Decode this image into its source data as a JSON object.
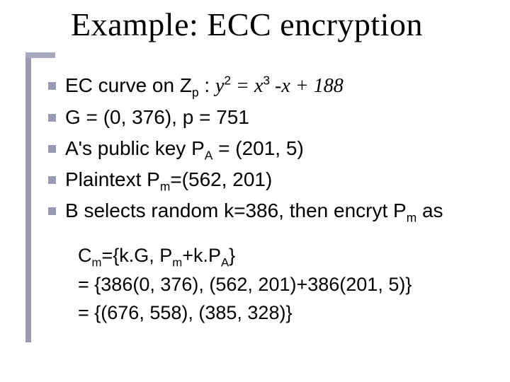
{
  "title": "Example: ECC encryption",
  "bullets": {
    "b1_prefix": "EC curve on Z",
    "b1_sub": "p",
    "b1_colon": " : ",
    "b1_y": "y",
    "b1_ysup": "2",
    "b1_eq": " = ",
    "b1_xcubed": "x",
    "b1_xsup": "3",
    "b1_mid": " -",
    "b1_x2": "x + ",
    "b1_const": "188",
    "b2": "G = (0, 376), p = 751",
    "b3_pre": "A's public key P",
    "b3_sub": "A",
    "b3_post": " = (201, 5)",
    "b4_pre": "Plaintext P",
    "b4_sub": "m",
    "b4_post": "=(562, 201)",
    "b5_pre": "B selects random k=386, then encryt P",
    "b5_sub": "m",
    "b5_post": " as"
  },
  "deriv": {
    "l1a": "C",
    "l1a_sub": "m",
    "l1b": "={k.G, P",
    "l1b_sub": "m",
    "l1c": "+k.P",
    "l1c_sub": "A",
    "l1d": "}",
    "l2": "= {386(0, 376), (562, 201)+386(201, 5)}",
    "l3": "= {(676, 558), (385, 328)}"
  }
}
